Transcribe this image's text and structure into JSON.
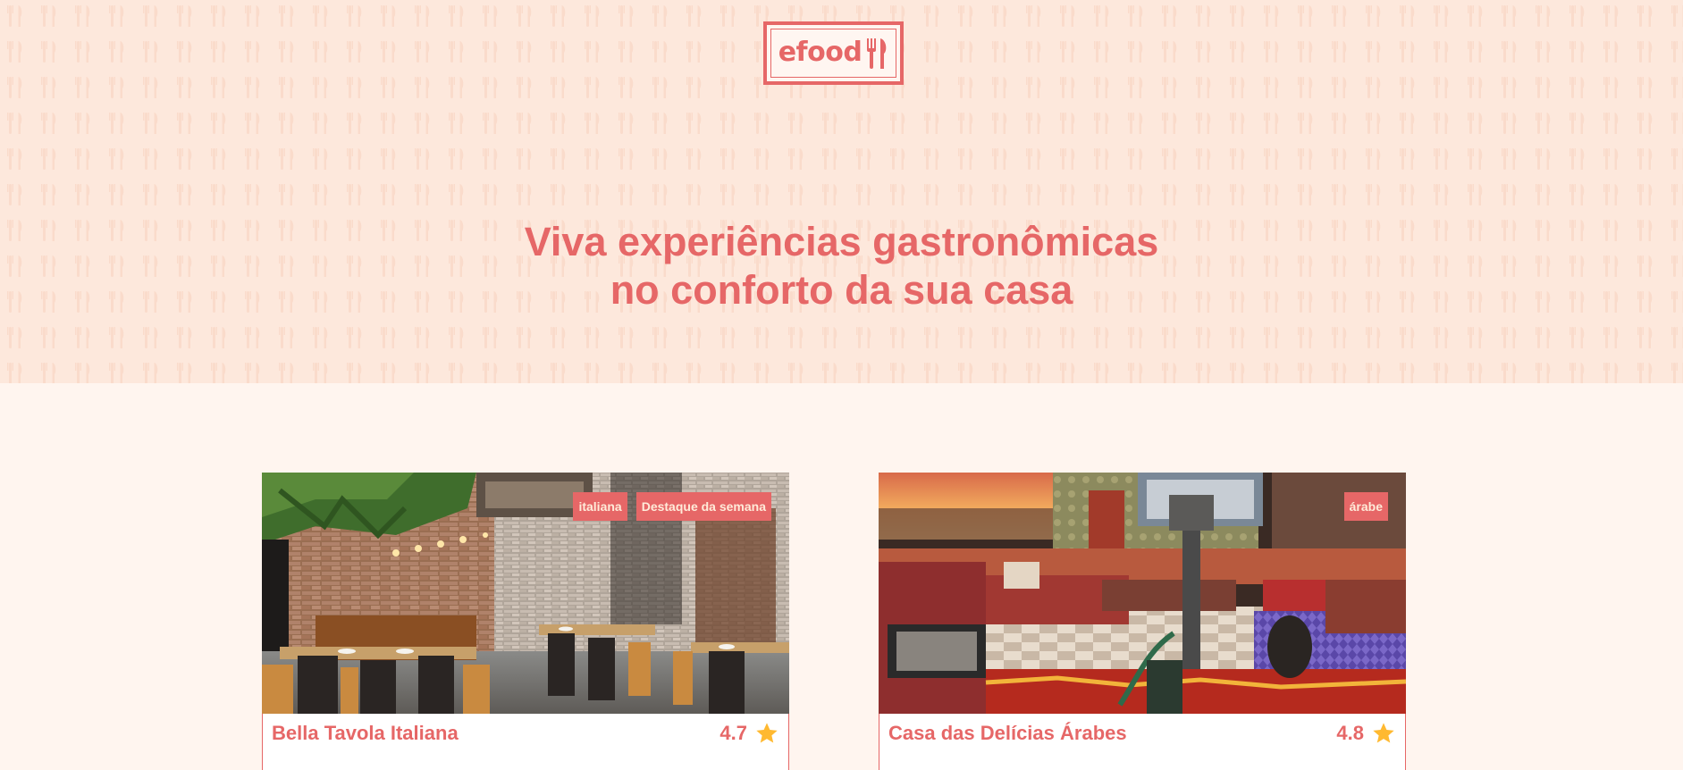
{
  "brand": {
    "logo_text": "efood"
  },
  "hero": {
    "title_line1": "Viva experiências gastronômicas",
    "title_line2": "no conforto da sua casa"
  },
  "restaurants": [
    {
      "name": "Bella Tavola Italiana",
      "rating": "4.7",
      "tags": [
        "italiana",
        "Destaque da semana"
      ],
      "image": "italian-restaurant-interior"
    },
    {
      "name": "Casa das Delícias Árabes",
      "rating": "4.8",
      "tags": [
        "árabe"
      ],
      "image": "arabic-restaurant-interior"
    }
  ],
  "colors": {
    "primary": "#E66767",
    "hero_background": "#FDE8DC",
    "page_background": "#FFF5EF",
    "tag_text": "#FFEBD9",
    "star": "#FFB930"
  },
  "icons": {
    "rating": "star-icon",
    "logo": "fork-knife-icon"
  }
}
